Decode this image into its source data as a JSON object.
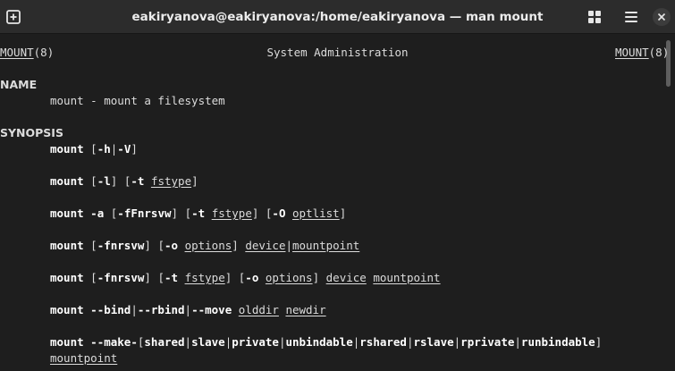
{
  "window": {
    "title": "eakiryanova@eakiryanova:/home/eakiryanova — man mount",
    "icons": {
      "new_tab": "new-tab-icon",
      "grid": "grid-view-icon",
      "menu": "hamburger-menu-icon",
      "close": "close-icon"
    }
  },
  "man": {
    "header_left": "MOUNT",
    "header_left_section": "(8)",
    "header_center": "System Administration",
    "header_right": "MOUNT",
    "header_right_section": "(8)",
    "name_heading": "NAME",
    "name_cmd": "mount",
    "name_desc": " - mount a filesystem",
    "synopsis_heading": "SYNOPSIS",
    "cmd": "mount",
    "s1": {
      "a": " [",
      "h": "-h",
      "pipe": "|",
      "v": "-V",
      "z": "]"
    },
    "s2": {
      "a": " [",
      "l": "-l",
      "b": "] [",
      "t": "-t",
      "sp": " ",
      "fstype": "fstype",
      "z": "]"
    },
    "s3": {
      "a": " ",
      "flag": "-a",
      "b": " [",
      "f": "-fFnrsvw",
      "c": "] [",
      "t": "-t",
      "sp1": " ",
      "fstype": "fstype",
      "d": "] [",
      "o": "-O",
      "sp2": " ",
      "optlist": "optlist",
      "z": "]"
    },
    "s4": {
      "a": " [",
      "f": "-fnrsvw",
      "b": "] [",
      "o": "-o",
      "sp": " ",
      "options": "options",
      "c": "] ",
      "device": "device",
      "pipe": "|",
      "mountpoint": "mountpoint"
    },
    "s5": {
      "a": " [",
      "f": "-fnrsvw",
      "b": "] [",
      "t": "-t",
      "sp1": " ",
      "fstype": "fstype",
      "c": "] [",
      "o": "-o",
      "sp2": " ",
      "options": "options",
      "d": "] ",
      "device": "device",
      "sp3": " ",
      "mountpoint": "mountpoint"
    },
    "s6": {
      "a": " ",
      "bind": "--bind",
      "p1": "|",
      "rbind": "--rbind",
      "p2": "|",
      "move": "--move",
      "sp1": " ",
      "olddir": "olddir",
      "sp2": " ",
      "newdir": "newdir"
    },
    "s7": {
      "a": " ",
      "make": "--make-",
      "ob": "[",
      "shared": "shared",
      "p1": "|",
      "slave": "slave",
      "p2": "|",
      "private": "private",
      "p3": "|",
      "unbindable": "unbindable",
      "p4": "|",
      "rshared": "rshared",
      "p5": "|",
      "rslave": "rslave",
      "p6": "|",
      "rprivate": "rprivate",
      "p7": "|",
      "runbindable": "runbindable",
      "cb": "]",
      "mountpoint": "mountpoint"
    }
  }
}
